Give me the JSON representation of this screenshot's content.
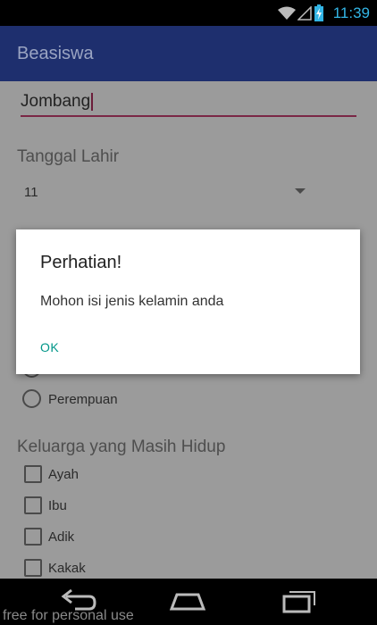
{
  "status_bar": {
    "time": "11:39"
  },
  "app_bar": {
    "title": "Beasiswa"
  },
  "form": {
    "city_value": "Jombang",
    "birth_date_label": "Tanggal Lahir",
    "birth_date_selected": "11",
    "gender_options": [
      "Perempuan"
    ],
    "family_label": "Keluarga yang Masih Hidup",
    "family_options": [
      "Ayah",
      "Ibu",
      "Adik",
      "Kakak"
    ]
  },
  "dialog": {
    "title": "Perhatian!",
    "message": "Mohon isi jenis kelamin anda",
    "ok_label": "OK"
  },
  "watermark": "free for personal use",
  "colors": {
    "app_bar": "#1e2f6e",
    "accent": "#7a2745",
    "dialog_button": "#009688",
    "status_time": "#33b5e5"
  }
}
